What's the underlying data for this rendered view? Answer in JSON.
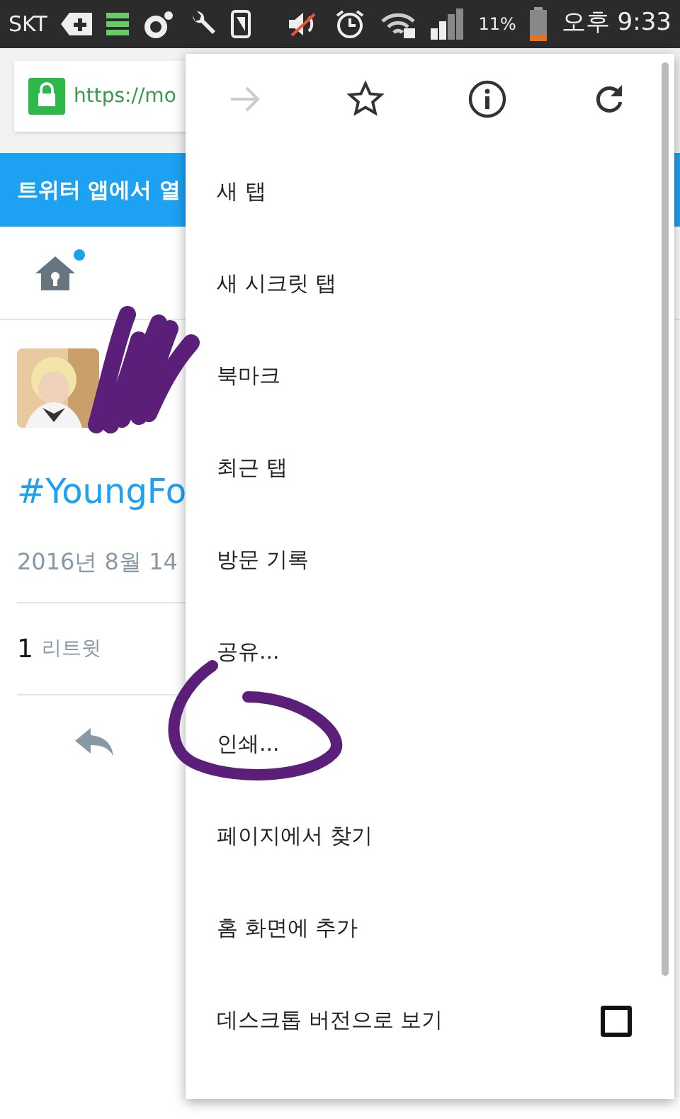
{
  "status_bar": {
    "carrier": "SKT",
    "battery": "11%",
    "time": "오후 9:33"
  },
  "address_bar": {
    "url": "https://mo"
  },
  "banner": {
    "text": "트위터 앱에서 열"
  },
  "nav": {
    "home_notification": true
  },
  "tweet": {
    "hashtag": "#YoungFo",
    "date": "2016년 8월 14",
    "retweet_count": "1",
    "retweet_label": "리트윗"
  },
  "menu": {
    "items": [
      {
        "kind": "item",
        "label": "새 탭"
      },
      {
        "kind": "item",
        "label": "새 시크릿 탭"
      },
      {
        "kind": "item",
        "label": "북마크"
      },
      {
        "kind": "item",
        "label": "최근 탭"
      },
      {
        "kind": "item",
        "label": "방문 기록"
      },
      {
        "kind": "item",
        "label": "공유..."
      },
      {
        "kind": "item",
        "label": "인쇄..."
      },
      {
        "kind": "item",
        "label": "페이지에서 찾기"
      },
      {
        "kind": "item",
        "label": "홈 화면에 추가"
      },
      {
        "kind": "checkbox",
        "label": "데스크톱 버전으로 보기",
        "checked": false
      }
    ]
  }
}
